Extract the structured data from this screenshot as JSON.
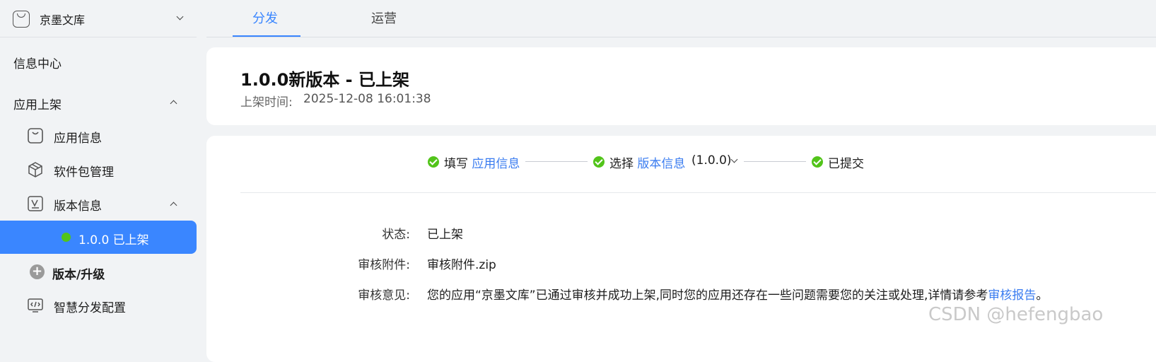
{
  "sidebar": {
    "app_name": "京墨文库",
    "info_center": "信息中心",
    "app_listing": "应用上架",
    "items": [
      {
        "label": "应用信息"
      },
      {
        "label": "软件包管理"
      },
      {
        "label": "版本信息"
      }
    ],
    "active_version": "1.0.0 已上架",
    "version_upgrade": "版本/升级",
    "smart_distribution": "智慧分发配置"
  },
  "tabs": {
    "distribute": "分发",
    "operate": "运营"
  },
  "header": {
    "title": "1.0.0新版本 - 已上架",
    "time_label": "上架时间:",
    "time_value": "2025-12-08 16:01:38"
  },
  "steps": {
    "step1_prefix": "填写",
    "step1_link": "应用信息",
    "step2_prefix": "选择",
    "step2_link": "版本信息",
    "step2_version": "(1.0.0)",
    "step3": "已提交"
  },
  "details": {
    "status_label": "状态:",
    "status_value": "已上架",
    "attachment_label": "审核附件:",
    "attachment_value": "审核附件.zip",
    "opinion_label": "审核意见:",
    "opinion_text": "您的应用“京墨文库”已通过审核并成功上架,同时您的应用还存在一些问题需要您的关注或处理,详情请参考",
    "opinion_link": "审核报告",
    "opinion_end": "。"
  },
  "watermark": "CSDN @hefengbao",
  "colors": {
    "accent": "#3a86ff",
    "success": "#52c41a",
    "link": "#3a7cf0"
  }
}
